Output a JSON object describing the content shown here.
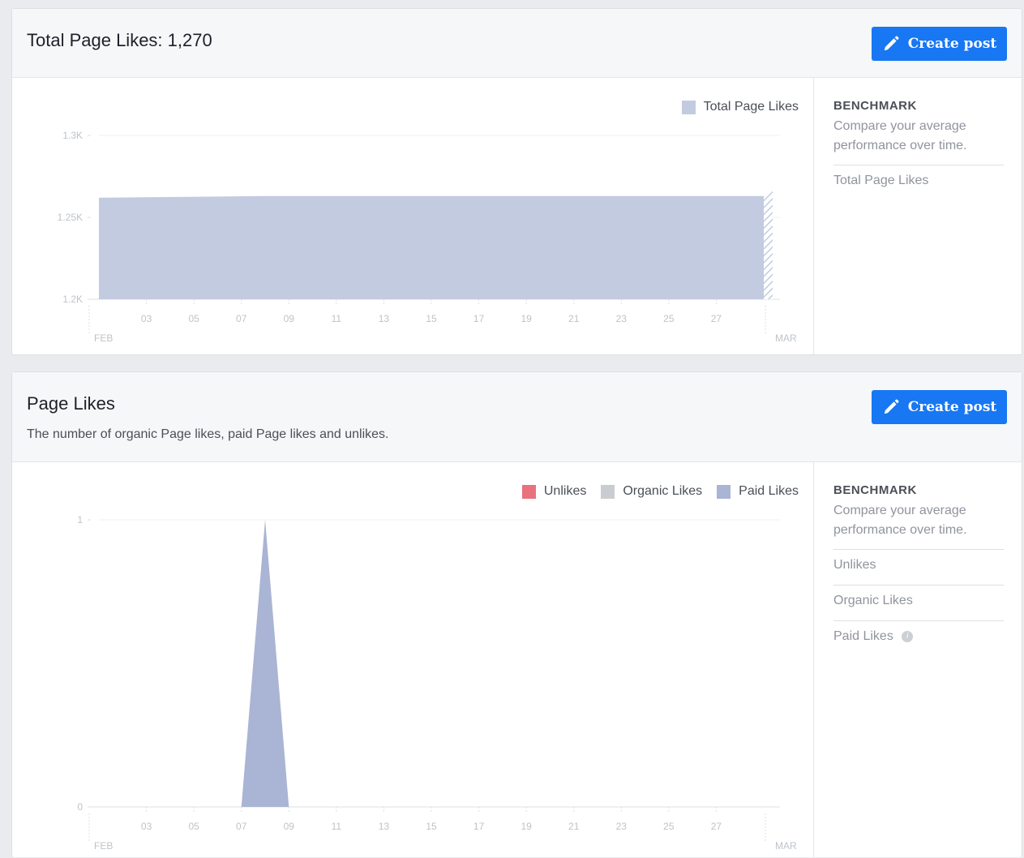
{
  "total_card": {
    "title": "Total Page Likes: 1,270",
    "button_label": "Create post",
    "legend": [
      {
        "label": "Total Page Likes",
        "color": "#c2cbe0"
      }
    ],
    "benchmark": {
      "title": "BENCHMARK",
      "description": "Compare your average performance over time.",
      "items": [
        "Total Page Likes"
      ]
    }
  },
  "likes_card": {
    "title": "Page Likes",
    "subtitle": "The number of organic Page likes, paid Page likes and unlikes.",
    "button_label": "Create post",
    "legend": [
      {
        "label": "Unlikes",
        "color": "#e8727e"
      },
      {
        "label": "Organic Likes",
        "color": "#c9ccd1"
      },
      {
        "label": "Paid Likes",
        "color": "#aab4d4"
      }
    ],
    "benchmark": {
      "title": "BENCHMARK",
      "description": "Compare your average performance over time.",
      "items": [
        "Unlikes",
        "Organic Likes",
        "Paid Likes"
      ],
      "info_icon": "info-icon"
    }
  },
  "chart_data": [
    {
      "type": "area",
      "series": [
        {
          "name": "Total Page Likes",
          "color": "#c2cbe0",
          "x": [
            "2019-02-01",
            "2019-02-08",
            "2019-03-01"
          ],
          "values": [
            1262,
            1263,
            1263
          ]
        }
      ],
      "yticks": [
        "1.3K",
        "1.25K",
        "1.2K"
      ],
      "ylim": [
        1200,
        1300
      ],
      "xticks": [
        "03",
        "05",
        "07",
        "09",
        "11",
        "13",
        "15",
        "17",
        "19",
        "21",
        "23",
        "25",
        "27"
      ],
      "x_month_labels": [
        "FEB",
        "MAR"
      ],
      "grid": true,
      "legend": "top-right"
    },
    {
      "type": "area",
      "series": [
        {
          "name": "Unlikes",
          "color": "#e8727e",
          "values": []
        },
        {
          "name": "Organic Likes",
          "color": "#c9ccd1",
          "values": []
        },
        {
          "name": "Paid Likes",
          "color": "#aab4d4",
          "x": [
            "2019-02-07",
            "2019-02-08",
            "2019-02-09"
          ],
          "values": [
            0,
            1,
            0
          ]
        }
      ],
      "yticks": [
        "1",
        "0"
      ],
      "ylim": [
        0,
        1
      ],
      "xticks": [
        "03",
        "05",
        "07",
        "09",
        "11",
        "13",
        "15",
        "17",
        "19",
        "21",
        "23",
        "25",
        "27"
      ],
      "x_month_labels": [
        "FEB",
        "MAR"
      ],
      "grid": true,
      "legend": "top-right"
    }
  ]
}
